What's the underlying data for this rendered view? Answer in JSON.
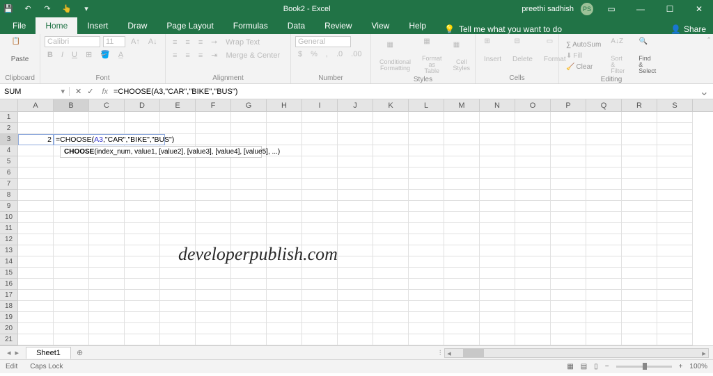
{
  "title": "Book2 - Excel",
  "user": "preethi sadhish",
  "user_initials": "PS",
  "tabs": {
    "file": "File",
    "home": "Home",
    "insert": "Insert",
    "draw": "Draw",
    "page_layout": "Page Layout",
    "formulas": "Formulas",
    "data": "Data",
    "review": "Review",
    "view": "View",
    "help": "Help"
  },
  "tell_me": "Tell me what you want to do",
  "share": "Share",
  "ribbon": {
    "clipboard": {
      "label": "Clipboard",
      "paste": "Paste"
    },
    "font": {
      "label": "Font",
      "name": "Calibri",
      "size": "11",
      "bold": "B",
      "italic": "I",
      "underline": "U"
    },
    "alignment": {
      "label": "Alignment",
      "wrap": "Wrap Text",
      "merge": "Merge & Center"
    },
    "number": {
      "label": "Number",
      "format": "General"
    },
    "styles": {
      "label": "Styles",
      "cond": "Conditional Formatting",
      "table": "Format as Table",
      "cell": "Cell Styles"
    },
    "cells": {
      "label": "Cells",
      "insert": "Insert",
      "delete": "Delete",
      "format": "Format"
    },
    "editing": {
      "label": "Editing",
      "autosum": "AutoSum",
      "fill": "Fill",
      "clear": "Clear",
      "sort": "Sort & Filter",
      "find": "Find & Select"
    }
  },
  "name_box": "SUM",
  "formula_bar": "=CHOOSE(A3,\"CAR\",\"BIKE\",\"BUS\")",
  "columns": [
    "A",
    "B",
    "C",
    "D",
    "E",
    "F",
    "G",
    "H",
    "I",
    "J",
    "K",
    "L",
    "M",
    "N",
    "O",
    "P",
    "Q",
    "R",
    "S"
  ],
  "rows": [
    1,
    2,
    3,
    4,
    5,
    6,
    7,
    8,
    9,
    10,
    11,
    12,
    13,
    14,
    15,
    16,
    17,
    18,
    19,
    20,
    21
  ],
  "cell_a3": "2",
  "editing_formula_prefix": "=CHOOSE(",
  "editing_formula_ref": "A3",
  "editing_formula_suffix": ",\"CAR\",\"BIKE\",\"BUS\")",
  "tooltip_func": "CHOOSE",
  "tooltip_args": "(index_num, value1, [value2], [value3], [value4], [value5], ...)",
  "watermark": "developerpublish.com",
  "sheet_name": "Sheet1",
  "status_edit": "Edit",
  "status_caps": "Caps Lock",
  "zoom": "100%"
}
